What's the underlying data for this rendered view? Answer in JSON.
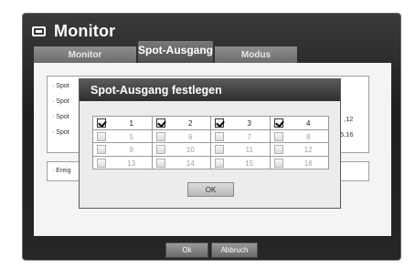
{
  "window": {
    "title": "Monitor",
    "icon": "monitor-icon"
  },
  "tabs": [
    {
      "label": "Monitor",
      "active": false
    },
    {
      "label": "Spot-Ausgang",
      "active": true
    },
    {
      "label": "Modus",
      "active": false
    }
  ],
  "panel": {
    "spot_lines": [
      "· Spot",
      "· Spot",
      "· Spot",
      "· Spot"
    ],
    "right_values": [
      ",12",
      "5,16"
    ],
    "event_label": "· Ereig"
  },
  "dialog": {
    "title": "Spot-Ausgang festlegen",
    "channels": [
      {
        "label": "1",
        "checked": true,
        "enabled": true
      },
      {
        "label": "2",
        "checked": true,
        "enabled": true
      },
      {
        "label": "3",
        "checked": true,
        "enabled": true
      },
      {
        "label": "4",
        "checked": true,
        "enabled": true
      },
      {
        "label": "5",
        "checked": false,
        "enabled": false
      },
      {
        "label": "6",
        "checked": false,
        "enabled": false
      },
      {
        "label": "7",
        "checked": false,
        "enabled": false
      },
      {
        "label": "8",
        "checked": false,
        "enabled": false
      },
      {
        "label": "9",
        "checked": false,
        "enabled": false
      },
      {
        "label": "10",
        "checked": false,
        "enabled": false
      },
      {
        "label": "11",
        "checked": false,
        "enabled": false
      },
      {
        "label": "12",
        "checked": false,
        "enabled": false
      },
      {
        "label": "13",
        "checked": false,
        "enabled": false
      },
      {
        "label": "14",
        "checked": false,
        "enabled": false
      },
      {
        "label": "15",
        "checked": false,
        "enabled": false
      },
      {
        "label": "16",
        "checked": false,
        "enabled": false
      }
    ],
    "ok_label": "OK"
  },
  "footer": {
    "ok_label": "Ok",
    "cancel_label": "Abbruch"
  }
}
